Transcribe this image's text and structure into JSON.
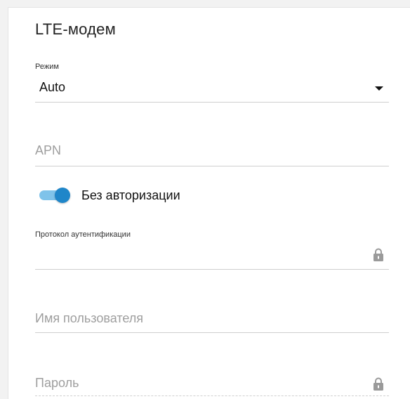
{
  "section": {
    "title": "LTE-модем"
  },
  "mode": {
    "label": "Режим",
    "value": "Auto"
  },
  "apn": {
    "placeholder": "APN"
  },
  "auth_toggle": {
    "label": "Без авторизации",
    "enabled": true
  },
  "auth_protocol": {
    "label": "Протокол аутентификации",
    "value": ""
  },
  "username": {
    "placeholder": "Имя пользователя"
  },
  "password": {
    "placeholder": "Пароль"
  },
  "colors": {
    "toggle_track": "#7fc3ea",
    "toggle_knob": "#1f86c9"
  },
  "icons": [
    "chevron-down-icon",
    "lock-icon"
  ]
}
